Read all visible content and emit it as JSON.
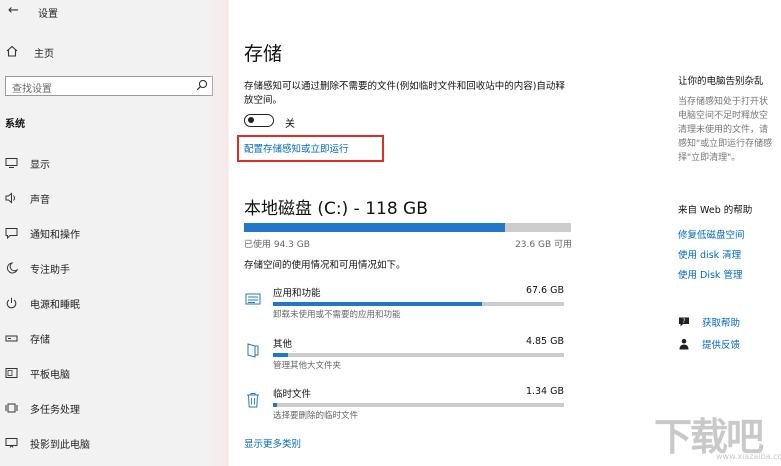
{
  "window": {
    "back_icon": "back-arrow-icon",
    "title": "设置"
  },
  "sidebar": {
    "home_label": "主页",
    "search_placeholder": "查找设置",
    "section_title": "系统",
    "items": [
      {
        "label": "显示",
        "icon": "display-icon"
      },
      {
        "label": "声音",
        "icon": "speaker-icon"
      },
      {
        "label": "通知和操作",
        "icon": "notification-icon"
      },
      {
        "label": "专注助手",
        "icon": "moon-icon"
      },
      {
        "label": "电源和睡眠",
        "icon": "power-icon"
      },
      {
        "label": "存储",
        "icon": "storage-icon"
      },
      {
        "label": "平板电脑",
        "icon": "tablet-icon"
      },
      {
        "label": "多任务处理",
        "icon": "multitasking-icon"
      },
      {
        "label": "投影到此电脑",
        "icon": "project-icon"
      }
    ]
  },
  "main": {
    "title": "存储",
    "description": "存储感知可以通过删除不需要的文件(例如临时文件和回收站中的内容)自动释放空间。",
    "toggle_state": "关",
    "toggle_on": false,
    "config_link": "配置存储感知或立即运行",
    "disk_title": "本地磁盘 (C:) - 118 GB",
    "disk_used": "已使用 94.3 GB",
    "disk_free": "23.6 GB 可用",
    "disk_used_fraction": 0.799,
    "usage_subtitle": "存储空间的使用情况和可用情况如下。",
    "categories": [
      {
        "name": "应用和功能",
        "size": "67.6 GB",
        "note": "卸载未使用或不需要的应用和功能",
        "fraction": 0.717,
        "icon": "apps-icon"
      },
      {
        "name": "其他",
        "size": "4.85 GB",
        "note": "管理其他大文件夹",
        "fraction": 0.051,
        "icon": "folder-icon"
      },
      {
        "name": "临时文件",
        "size": "1.34 GB",
        "note": "选择要删除的临时文件",
        "fraction": 0.014,
        "icon": "trash-icon"
      }
    ],
    "show_more": "显示更多类别"
  },
  "right_panel": {
    "heading": "让你的电脑告别杂乱",
    "paragraph_lines": [
      "当存储感知处于打开状",
      "电脑空间不足时释放空",
      "清理未使用的文件，请",
      "感知\"或立即运行存储感",
      "择\"立即清理\"。"
    ],
    "help_heading": "来自 Web 的帮助",
    "help_links": [
      "修复低磁盘空间",
      "使用 disk 清理",
      "使用 Disk 管理"
    ],
    "get_help": "获取帮助",
    "feedback": "提供反馈"
  },
  "watermark": {
    "big": "下载吧",
    "small": "www.xiazaiba.com"
  },
  "colors": {
    "accent": "#2178c9",
    "link": "#0067c0",
    "highlight_box": "#e02b2b",
    "sidebar_bg": "#f2f2f2"
  }
}
